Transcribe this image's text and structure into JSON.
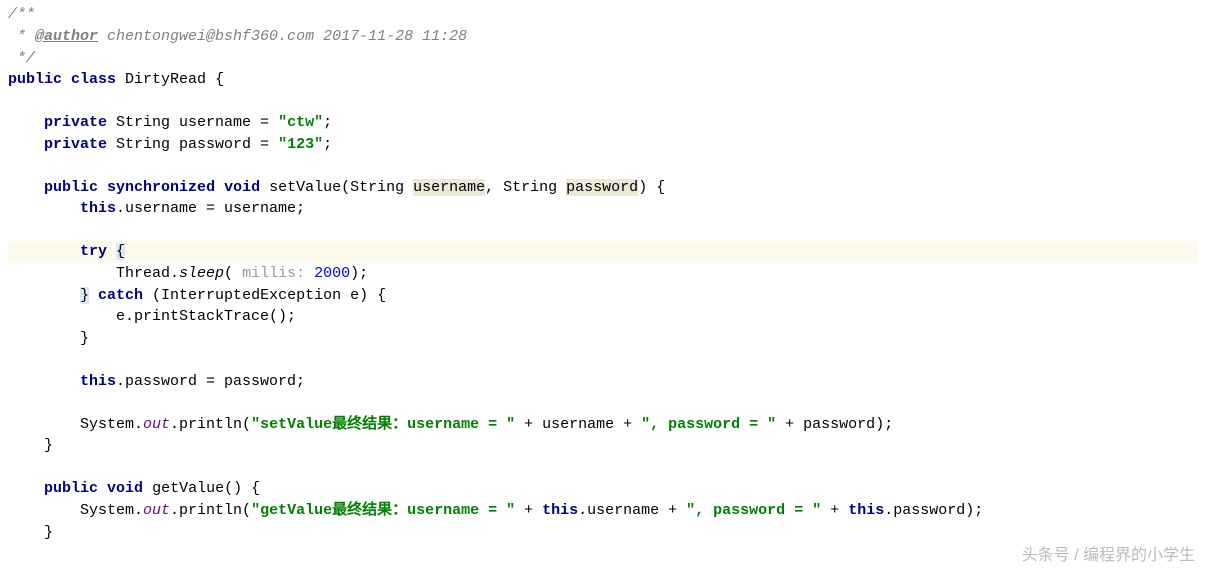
{
  "javadoc": {
    "start": "/**",
    "author_tag": "@author",
    "author_text": " chentongwei@bshf360.com 2017-11-28 11:28",
    "end": " */"
  },
  "class_decl": {
    "public": "public",
    "class": "class",
    "name": " DirtyRead {"
  },
  "field1": {
    "private": "private",
    "type": " String username = ",
    "value": "\"ctw\"",
    "semi": ";"
  },
  "field2": {
    "private": "private",
    "type": " String password = ",
    "value": "\"123\"",
    "semi": ";"
  },
  "method1": {
    "public": "public",
    "sync": "synchronized",
    "void": "void",
    "name_pre": " setValue(String ",
    "param1": "username",
    "mid": ", String ",
    "param2": "password",
    "end": ") {"
  },
  "line_assign1": {
    "this": "this",
    "rest": ".username = username;"
  },
  "try_line": {
    "try": "try",
    "brace": " {"
  },
  "sleep_line": {
    "pre": "            Thread.",
    "sleep": "sleep",
    "paren": "( ",
    "hint": "millis: ",
    "num": "2000",
    "end": ");"
  },
  "catch_line": {
    "close_brace": "}",
    "catch": " catch",
    "rest": " (InterruptedException e) {"
  },
  "print_stack": "            e.printStackTrace();",
  "close_try": "        }",
  "line_assign2": {
    "this": "this",
    "rest": ".password = password;"
  },
  "sysout1": {
    "pre": "        System.",
    "out": "out",
    "print": ".println(",
    "str1": "\"setValue最终结果：username = \"",
    "mid1": " + username + ",
    "str2": "\", password = \"",
    "mid2": " + password);",
    "close": "    }"
  },
  "method2": {
    "public": "public",
    "void": "void",
    "name": " getValue() {"
  },
  "sysout2": {
    "pre": "        System.",
    "out": "out",
    "print": ".println(",
    "str1": "\"getValue最终结果：username = \"",
    "mid1": " + ",
    "this1": "this",
    "mid2": ".username + ",
    "str2": "\", password = \"",
    "mid3": " + ",
    "this2": "this",
    "mid4": ".password);",
    "close": "    }"
  },
  "watermark": "头条号 / 编程界的小学生"
}
